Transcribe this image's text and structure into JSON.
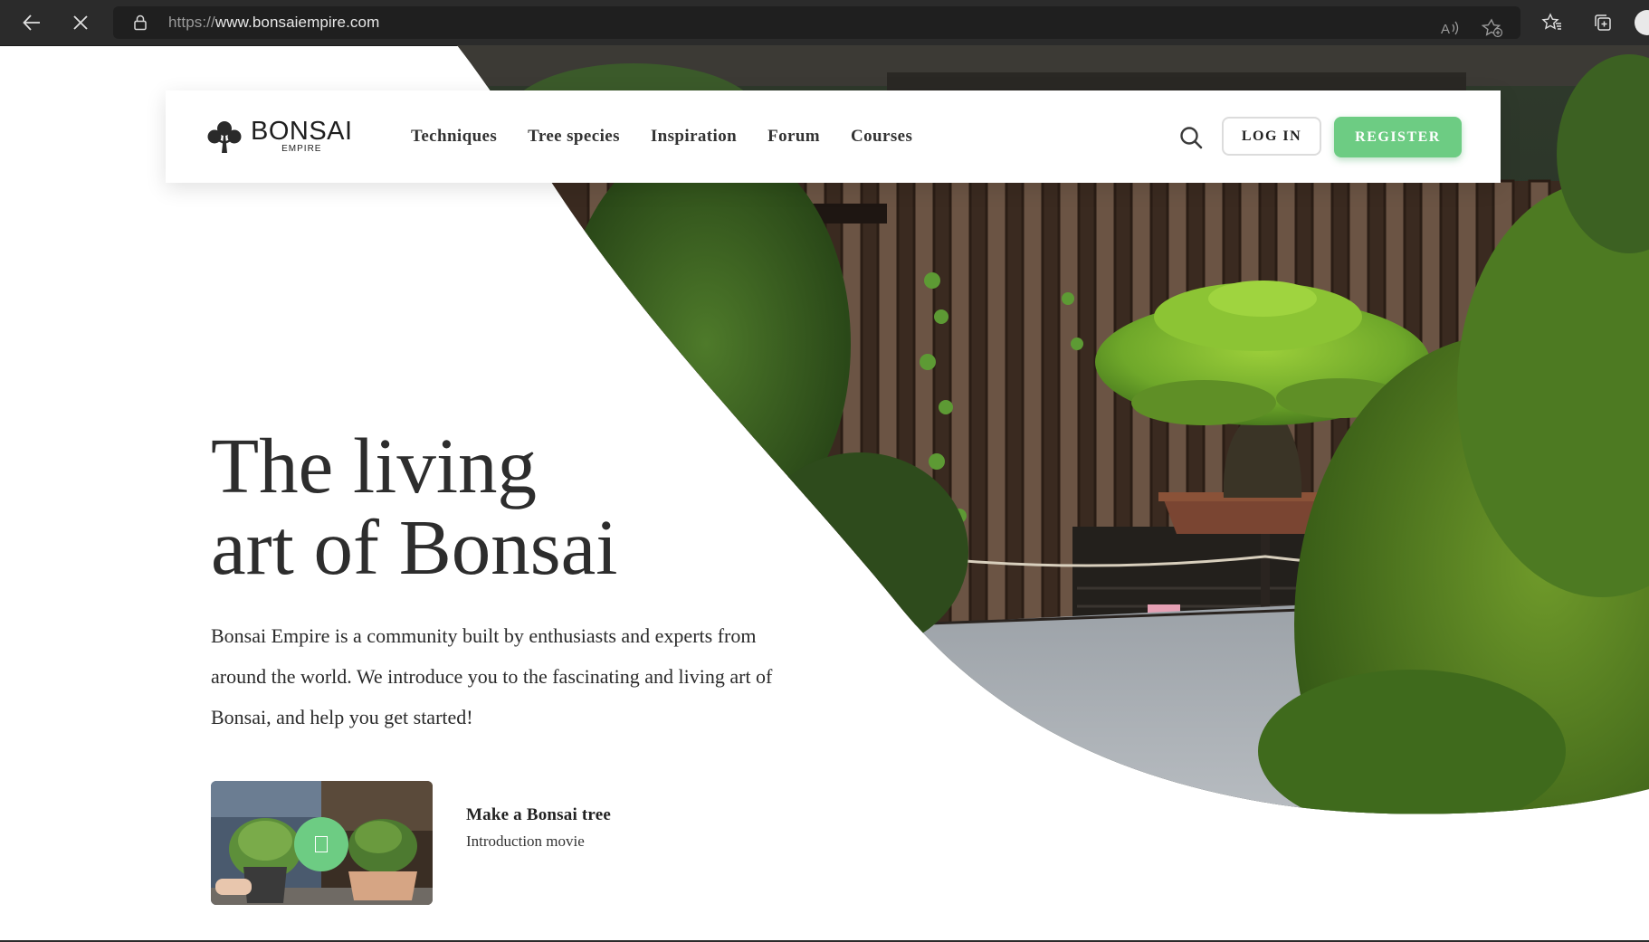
{
  "browser": {
    "url_scheme": "https://",
    "url_host": "www.bonsaiempire.com",
    "icons": [
      "back-arrow-icon",
      "stop-loading-icon",
      "lock-icon",
      "read-aloud-icon",
      "add-favorite-icon",
      "favorites-icon",
      "collections-icon",
      "profile-avatar"
    ]
  },
  "header": {
    "logo_text": "BONSAI",
    "logo_subtext": "EMPIRE",
    "nav": [
      "Techniques",
      "Tree species",
      "Inspiration",
      "Forum",
      "Courses"
    ],
    "login_label": "LOG IN",
    "register_label": "REGISTER"
  },
  "hero": {
    "title_line1": "The living",
    "title_line2": "art of Bonsai",
    "description": "Bonsai Empire is a community built by enthusiasts and experts from around the world. We introduce you to the fascinating and living art of Bonsai, and help you get started!",
    "video_title": "Make a Bonsai tree",
    "video_subtitle": "Introduction movie"
  },
  "colors": {
    "accent_green": "#6dcc83",
    "chrome_bg": "#2b2b2b",
    "text_dark": "#2d2d2d"
  }
}
